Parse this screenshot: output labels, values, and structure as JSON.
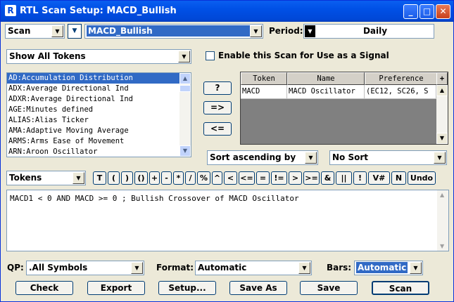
{
  "window": {
    "title": "RTL Scan Setup: MACD_Bullish",
    "minimize_label": "_",
    "maximize_label": "□",
    "close_label": "✕"
  },
  "top": {
    "scan_type": "Scan",
    "scan_name": "MACD_Bullish",
    "period_label": "Period:",
    "period_value": "Daily"
  },
  "tokens_filter": "Show All Tokens",
  "signal_checkbox": {
    "label": "Enable this Scan for Use as a Signal",
    "checked": false
  },
  "token_list": [
    "AD:Accumulation Distribution",
    "ADX:Average Directional Ind",
    "ADXR:Average Directional Ind",
    "AGE:Minutes defined",
    "ALIAS:Alias Ticker",
    "AMA:Adaptive Moving Average",
    "ARMS:Arms Ease of Movement",
    "ARN:Aroon Oscillator"
  ],
  "middle_buttons": {
    "help": "?",
    "add": "=>",
    "remove": "<="
  },
  "grid": {
    "headers": [
      "Token",
      "Name",
      "Preference"
    ],
    "corner_label": "+",
    "rows": [
      [
        "MACD",
        "MACD Oscillator",
        "(EC12, SC26, S"
      ]
    ]
  },
  "sort": {
    "sort_by": "Sort ascending by",
    "sort_field": "No Sort"
  },
  "operators": {
    "mode": "Tokens",
    "buttons": [
      "T",
      "(",
      ")",
      "()",
      "+",
      "-",
      "*",
      "/",
      "%",
      "^",
      "<",
      "<=",
      "=",
      "!=",
      ">",
      ">=",
      "&",
      "||",
      "!",
      "V#",
      "N",
      "Undo"
    ]
  },
  "formula": "MACD1 < 0 AND MACD >= 0 ; Bullish Crossover of MACD Oscillator",
  "bottom": {
    "qp_label": "QP:",
    "qp_value": ".All Symbols",
    "format_label": "Format:",
    "format_value": "Automatic",
    "bars_label": "Bars:",
    "bars_value": "Automatic"
  },
  "actions": {
    "check": "Check",
    "export": "Export",
    "setup": "Setup...",
    "save_as": "Save As",
    "save": "Save",
    "scan": "Scan"
  },
  "icons": {
    "arrow": "▼",
    "arrow_up": "▲",
    "app": "R"
  },
  "colors": {
    "titlebar": "#0050e6",
    "selection": "#316ac5",
    "face": "#ece9d8"
  }
}
